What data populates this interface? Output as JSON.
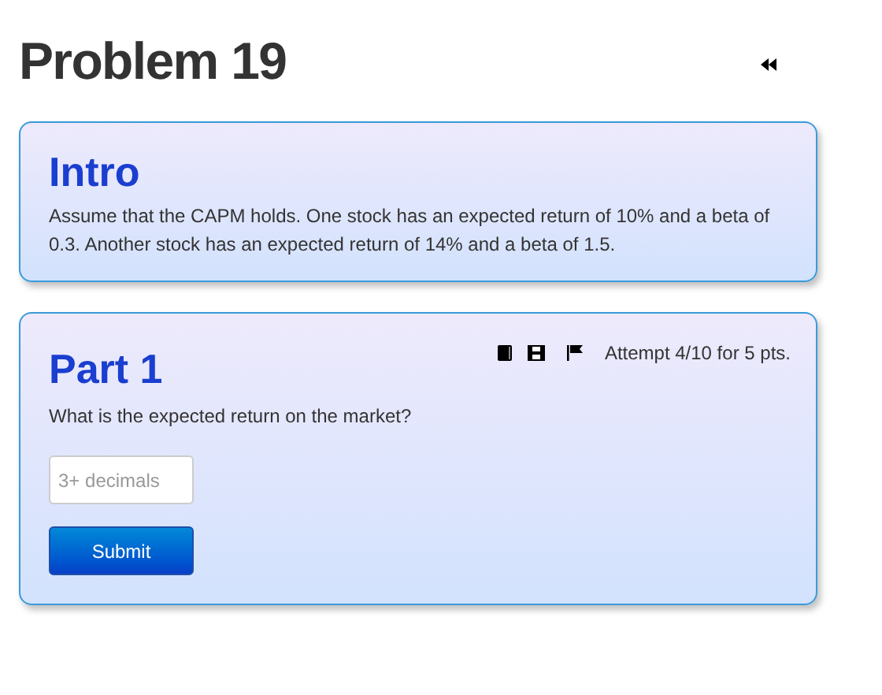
{
  "title": "Problem 19",
  "intro": {
    "heading": "Intro",
    "text": "Assume that the CAPM holds. One stock has an expected return of 10% and a beta of 0.3. Another stock has an expected return of 14% and a beta of 1.5."
  },
  "parts": [
    {
      "heading": "Part 1",
      "attempt": "Attempt 4/10 for 5 pts.",
      "question": "What is the expected return on the market?",
      "answer": {
        "placeholder": "3+ decimals"
      },
      "button": "Submit"
    }
  ]
}
